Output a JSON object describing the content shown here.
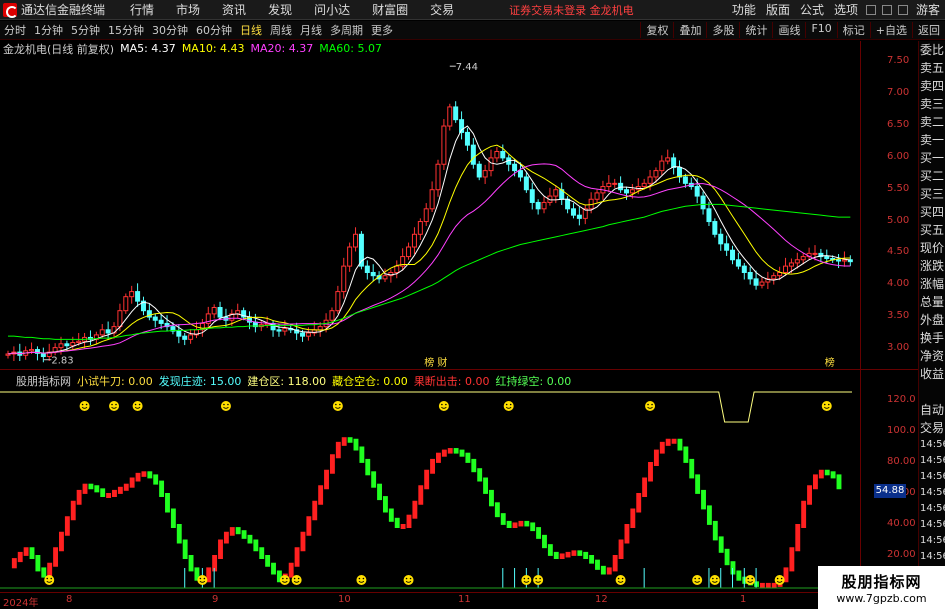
{
  "app": {
    "name": "通达信金融终端",
    "menu": [
      "行情",
      "市场",
      "资讯",
      "发现",
      "问小达",
      "财富圈",
      "交易"
    ],
    "notice": "证券交易未登录  金龙机电",
    "right_menu": [
      "功能",
      "版面",
      "公式",
      "选项"
    ],
    "guest": "游客"
  },
  "toolbar": {
    "timeframes": [
      "分时",
      "1分钟",
      "5分钟",
      "15分钟",
      "30分钟",
      "60分钟",
      "日线",
      "周线",
      "月线",
      "多周期",
      "更多"
    ],
    "active": "日线",
    "right_buttons": [
      "复权",
      "叠加",
      "多股",
      "统计",
      "画线",
      "F10",
      "标记",
      "+自选",
      "返回"
    ]
  },
  "stock": {
    "label": "金龙机电(日线 前复权)",
    "ma5": "MA5: 4.37",
    "ma10": "MA10: 4.43",
    "ma20": "MA20: 4.37",
    "ma60": "MA60: 5.07",
    "high_label": "7.44",
    "low_label": "2.83",
    "event_labels": [
      "榜 财",
      "榜"
    ]
  },
  "colors": {
    "up": "#ff3232",
    "down": "#54ffff",
    "ma5": "#ffffff",
    "ma10": "#ffff00",
    "ma20": "#ff40ff",
    "ma60": "#00ff00",
    "axis": "#cc3333"
  },
  "price_axis": {
    "ticks": [
      "7.50",
      "7.00",
      "6.50",
      "6.00",
      "5.50",
      "5.00",
      "4.50",
      "4.00",
      "3.50",
      "3.00"
    ],
    "min": 2.7,
    "max": 7.6
  },
  "indicator": {
    "name": "股朋指标网",
    "items": [
      {
        "label": "小试牛刀: 0.00",
        "color": "#ffdf40"
      },
      {
        "label": "发现庄迹: 15.00",
        "color": "#54ffff"
      },
      {
        "label": "建仓区: 118.00",
        "color": "#ffff80"
      },
      {
        "label": "藏仓空仓: 0.00",
        "color": "#ffff00"
      },
      {
        "label": "果断出击: 0.00",
        "color": "#ff3232"
      },
      {
        "label": "红持绿空: 0.00",
        "color": "#54ff54"
      }
    ],
    "ticks": [
      "120.0",
      "100.0",
      "80.00",
      "60.00",
      "40.00",
      "20.00"
    ],
    "current_value": "54.88"
  },
  "side_panel": [
    "委比",
    "卖五",
    "卖四",
    "卖三",
    "卖二",
    "卖一",
    "买一",
    "买二",
    "买三",
    "买四",
    "买五",
    "现价",
    "涨跌",
    "涨幅",
    "总量",
    "外盘",
    "换手",
    "净资",
    "收益",
    "",
    "自动",
    "交易",
    "14:56",
    "14:56",
    "14:56",
    "14:56",
    "14:56",
    "14:56",
    "14:56",
    "14:56",
    "14:56"
  ],
  "xaxis": [
    "2024年",
    "8",
    "9",
    "10",
    "11",
    "12",
    "1"
  ],
  "watermark": {
    "title": "股朋指标网",
    "url": "www.7gpzb.com"
  },
  "chart_data": {
    "type": "candlestick",
    "price_min": 2.7,
    "price_max": 7.6,
    "closes": [
      2.92,
      2.95,
      2.9,
      2.97,
      2.99,
      2.93,
      2.88,
      2.95,
      3.02,
      3.08,
      3.05,
      3.1,
      3.12,
      3.18,
      3.15,
      3.22,
      3.3,
      3.25,
      3.35,
      3.6,
      3.82,
      3.9,
      3.75,
      3.6,
      3.5,
      3.45,
      3.4,
      3.35,
      3.28,
      3.2,
      3.15,
      3.22,
      3.3,
      3.4,
      3.55,
      3.65,
      3.5,
      3.45,
      3.55,
      3.6,
      3.5,
      3.42,
      3.35,
      3.38,
      3.4,
      3.3,
      3.28,
      3.32,
      3.3,
      3.25,
      3.2,
      3.25,
      3.3,
      3.35,
      3.45,
      3.6,
      3.9,
      4.3,
      4.6,
      4.8,
      4.3,
      4.2,
      4.15,
      4.1,
      4.15,
      4.2,
      4.3,
      4.45,
      4.6,
      4.8,
      5.0,
      5.2,
      5.5,
      5.9,
      6.5,
      6.8,
      6.6,
      6.4,
      6.2,
      5.9,
      5.7,
      5.8,
      6.0,
      6.1,
      6.0,
      5.9,
      5.8,
      5.7,
      5.5,
      5.3,
      5.2,
      5.3,
      5.4,
      5.5,
      5.35,
      5.2,
      5.1,
      5.05,
      5.2,
      5.35,
      5.45,
      5.55,
      5.6,
      5.6,
      5.5,
      5.45,
      5.5,
      5.55,
      5.6,
      5.7,
      5.8,
      5.95,
      6.0,
      5.85,
      5.7,
      5.6,
      5.55,
      5.4,
      5.2,
      5.0,
      4.8,
      4.65,
      4.55,
      4.4,
      4.3,
      4.2,
      4.1,
      4.0,
      4.05,
      4.1,
      4.15,
      4.2,
      4.3,
      4.35,
      4.4,
      4.45,
      4.5,
      4.5,
      4.45,
      4.42,
      4.4,
      4.38,
      4.4,
      4.37
    ],
    "ma60": [
      3.2,
      3.2,
      3.19,
      3.18,
      3.18,
      3.17,
      3.16,
      3.16,
      3.15,
      3.15,
      3.15,
      3.15,
      3.15,
      3.15,
      3.16,
      3.16,
      3.17,
      3.17,
      3.18,
      3.19,
      3.21,
      3.22,
      3.24,
      3.25,
      3.26,
      3.27,
      3.28,
      3.28,
      3.29,
      3.29,
      3.29,
      3.3,
      3.3,
      3.31,
      3.32,
      3.33,
      3.33,
      3.34,
      3.34,
      3.35,
      3.35,
      3.36,
      3.36,
      3.36,
      3.37,
      3.37,
      3.37,
      3.37,
      3.37,
      3.37,
      3.37,
      3.38,
      3.38,
      3.39,
      3.4,
      3.42,
      3.45,
      3.48,
      3.52,
      3.56,
      3.59,
      3.62,
      3.65,
      3.68,
      3.71,
      3.74,
      3.77,
      3.8,
      3.84,
      3.88,
      3.92,
      3.96,
      4.0,
      4.05,
      4.11,
      4.17,
      4.23,
      4.28,
      4.32,
      4.36,
      4.4,
      4.44,
      4.48,
      4.52,
      4.55,
      4.58,
      4.61,
      4.64,
      4.66,
      4.68,
      4.7,
      4.72,
      4.74,
      4.76,
      4.78,
      4.8,
      4.82,
      4.84,
      4.86,
      4.88,
      4.9,
      4.92,
      4.95,
      4.97,
      4.99,
      5.01,
      5.03,
      5.05,
      5.07,
      5.1,
      5.13,
      5.16,
      5.18,
      5.2,
      5.22,
      5.24,
      5.25,
      5.26,
      5.27,
      5.27,
      5.27,
      5.27,
      5.26,
      5.25,
      5.24,
      5.23,
      5.22,
      5.21,
      5.2,
      5.19,
      5.18,
      5.17,
      5.16,
      5.15,
      5.14,
      5.13,
      5.12,
      5.11,
      5.1,
      5.09,
      5.08,
      5.07,
      5.07,
      5.07
    ],
    "oscillator": [
      14,
      18,
      22,
      25,
      20,
      12,
      8,
      15,
      25,
      35,
      45,
      55,
      62,
      66,
      65,
      63,
      60,
      60,
      62,
      64,
      66,
      70,
      73,
      74,
      72,
      68,
      60,
      50,
      40,
      30,
      20,
      12,
      6,
      5,
      12,
      20,
      30,
      35,
      38,
      36,
      33,
      30,
      25,
      20,
      15,
      10,
      5,
      8,
      15,
      25,
      35,
      45,
      55,
      65,
      75,
      85,
      93,
      96,
      95,
      90,
      82,
      74,
      66,
      58,
      50,
      44,
      40,
      40,
      46,
      55,
      65,
      75,
      82,
      86,
      88,
      89,
      88,
      86,
      82,
      76,
      70,
      62,
      54,
      47,
      42,
      40,
      41,
      42,
      41,
      38,
      33,
      27,
      22,
      20,
      21,
      22,
      23,
      22,
      20,
      17,
      13,
      10,
      12,
      20,
      30,
      40,
      50,
      60,
      70,
      80,
      88,
      93,
      95,
      95,
      90,
      82,
      72,
      62,
      52,
      42,
      32,
      24,
      16,
      10,
      6,
      4,
      3,
      2,
      2,
      2,
      2,
      5,
      12,
      25,
      40,
      55,
      65,
      72,
      75,
      74,
      72,
      65
    ],
    "smiley_top_index": [
      13,
      18,
      22,
      37,
      56,
      74,
      85,
      109,
      139
    ],
    "smiley_bottom_index": [
      7,
      33,
      47,
      49,
      60,
      68,
      88,
      90,
      104,
      117,
      120,
      126,
      131
    ],
    "ind_ticks": [
      120,
      100,
      80,
      60,
      40,
      20
    ]
  }
}
